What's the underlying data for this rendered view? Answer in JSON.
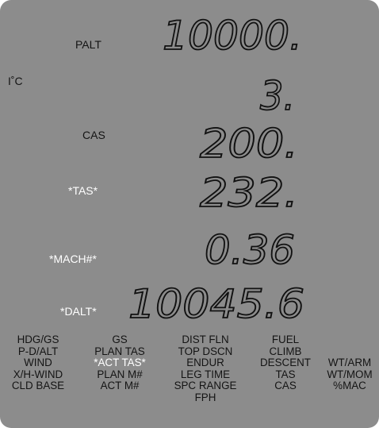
{
  "display": {
    "palt": {
      "label": "PALT",
      "value": "10000."
    },
    "temp": {
      "label": "I˚C",
      "value": "3."
    },
    "cas": {
      "label": "CAS",
      "value": "200."
    },
    "tas": {
      "label": "*TAS*",
      "value": "232."
    },
    "mach": {
      "label": "*MACH#*",
      "value": "0.36"
    },
    "dalt": {
      "label": "*DALT*",
      "value": "10045.6"
    }
  },
  "modes": {
    "col1": [
      "HDG/GS",
      "P-D/ALT",
      "WIND",
      "X/H-WIND",
      "CLD BASE"
    ],
    "col2": [
      "GS",
      "PLAN TAS",
      "*ACT TAS*",
      "PLAN M#",
      "ACT M#"
    ],
    "col3": [
      "DIST FLN",
      "TOP DSCN",
      "ENDUR",
      "LEG TIME",
      "SPC RANGE",
      "FPH"
    ],
    "col4": [
      "FUEL",
      "CLIMB",
      "DESCENT",
      "TAS",
      "CAS"
    ],
    "col5": [
      "WT/ARM",
      "WT/MOM",
      "%MAC"
    ]
  },
  "colors": {
    "screen": "#8c8c8c",
    "segment": "#111111",
    "active": "#ffffff"
  }
}
